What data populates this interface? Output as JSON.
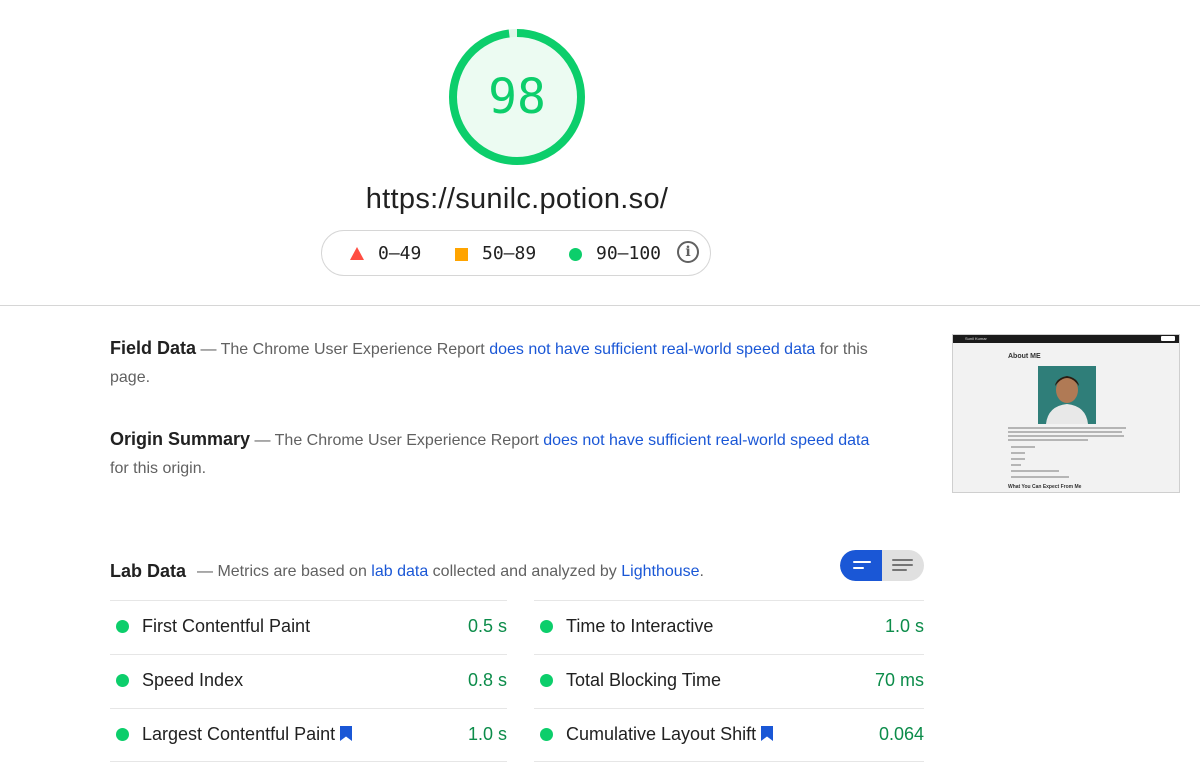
{
  "colors": {
    "pass": "#0cce6b",
    "average": "#ffa400",
    "fail": "#ff4e42",
    "link": "#1a57d6",
    "pass_text": "#0c8c4a"
  },
  "score": {
    "value": "98",
    "fraction": 0.98
  },
  "url": "https://sunilc.potion.so/",
  "legend": {
    "items": [
      {
        "shape": "triangle",
        "color": "#ff4e42",
        "label": "0–49"
      },
      {
        "shape": "square",
        "color": "#ffa400",
        "label": "50–89"
      },
      {
        "shape": "circle",
        "color": "#0cce6b",
        "label": "90–100"
      }
    ],
    "info_icon": "info-icon"
  },
  "field_data": {
    "title": "Field Data",
    "prefix": " — The Chrome User Experience Report ",
    "link": "does not have sufficient real-world speed data",
    "suffix": " for this page."
  },
  "origin_summary": {
    "title": "Origin Summary",
    "prefix": " — The Chrome User Experience Report ",
    "link": "does not have sufficient real-world speed data",
    "suffix": " for this origin."
  },
  "thumbnail": {
    "nav_name": "Sunil Kumar",
    "heading": "About ME",
    "footer_heading": "What You Can Expect From Me"
  },
  "lab_data": {
    "title": "Lab Data",
    "desc_prefix": "— Metrics are based on ",
    "link1": "lab data",
    "desc_middle": " collected and analyzed by ",
    "link2": "Lighthouse",
    "desc_suffix": ".",
    "view_toggle": {
      "left_icon": "list-view-icon",
      "right_icon": "detail-view-icon"
    },
    "metrics": [
      {
        "name": "First Contentful Paint",
        "value": "0.5 s",
        "status": "pass",
        "bookmark": false
      },
      {
        "name": "Speed Index",
        "value": "0.8 s",
        "status": "pass",
        "bookmark": false
      },
      {
        "name": "Largest Contentful Paint",
        "value": "1.0 s",
        "status": "pass",
        "bookmark": true
      },
      {
        "name": "Time to Interactive",
        "value": "1.0 s",
        "status": "pass",
        "bookmark": false
      },
      {
        "name": "Total Blocking Time",
        "value": "70 ms",
        "status": "pass",
        "bookmark": false
      },
      {
        "name": "Cumulative Layout Shift",
        "value": "0.064",
        "status": "pass",
        "bookmark": true
      }
    ]
  }
}
